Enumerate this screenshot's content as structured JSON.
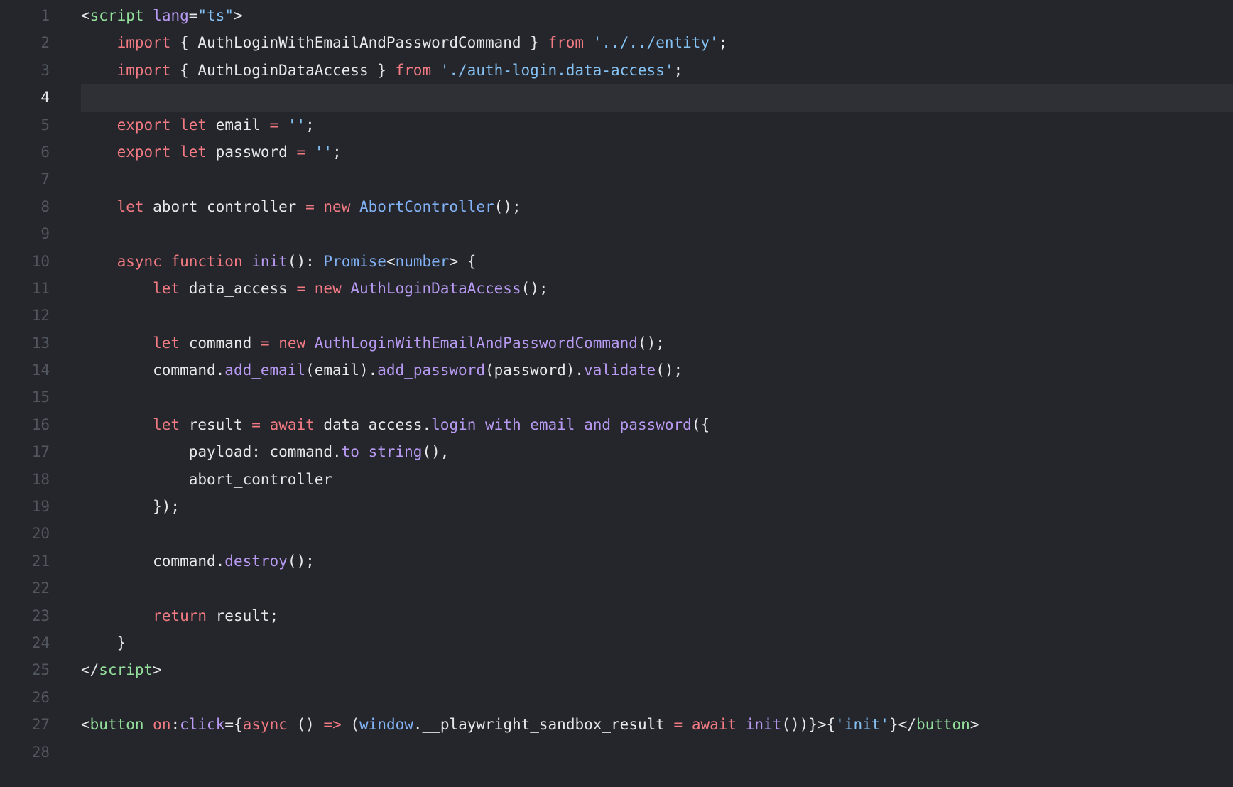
{
  "editor": {
    "active_line": 4,
    "colors": {
      "background": "#24262b",
      "active_line_background": "#2e3036",
      "line_number": "#52565e",
      "line_number_active": "#e4e6ea",
      "plain": "#e7e8ea",
      "keyword": "#f27a83",
      "string": "#85c1f3",
      "type": "#82b1f5",
      "function": "#b99af3",
      "tag": "#93df9b"
    },
    "lines": [
      {
        "n": "1",
        "tokens": [
          [
            "<",
            "punct"
          ],
          [
            "script",
            "tag"
          ],
          [
            " ",
            "plain"
          ],
          [
            "lang",
            "attr"
          ],
          [
            "=",
            "punct"
          ],
          [
            "\"ts\"",
            "str"
          ],
          [
            ">",
            "punct"
          ]
        ]
      },
      {
        "n": "2",
        "tokens": [
          [
            "    ",
            "plain"
          ],
          [
            "import",
            "kw"
          ],
          [
            " { AuthLoginWithEmailAndPasswordCommand } ",
            "plain"
          ],
          [
            "from",
            "kw"
          ],
          [
            " ",
            "plain"
          ],
          [
            "'../../entity'",
            "str"
          ],
          [
            ";",
            "punct"
          ]
        ]
      },
      {
        "n": "3",
        "tokens": [
          [
            "    ",
            "plain"
          ],
          [
            "import",
            "kw"
          ],
          [
            " { AuthLoginDataAccess } ",
            "plain"
          ],
          [
            "from",
            "kw"
          ],
          [
            " ",
            "plain"
          ],
          [
            "'./auth-login.data-access'",
            "str"
          ],
          [
            ";",
            "punct"
          ]
        ]
      },
      {
        "n": "4",
        "tokens": []
      },
      {
        "n": "5",
        "tokens": [
          [
            "    ",
            "plain"
          ],
          [
            "export",
            "kw"
          ],
          [
            " ",
            "plain"
          ],
          [
            "let",
            "kw"
          ],
          [
            " email ",
            "plain"
          ],
          [
            "=",
            "op"
          ],
          [
            " ",
            "plain"
          ],
          [
            "''",
            "str"
          ],
          [
            ";",
            "punct"
          ]
        ]
      },
      {
        "n": "6",
        "tokens": [
          [
            "    ",
            "plain"
          ],
          [
            "export",
            "kw"
          ],
          [
            " ",
            "plain"
          ],
          [
            "let",
            "kw"
          ],
          [
            " password ",
            "plain"
          ],
          [
            "=",
            "op"
          ],
          [
            " ",
            "plain"
          ],
          [
            "''",
            "str"
          ],
          [
            ";",
            "punct"
          ]
        ]
      },
      {
        "n": "7",
        "tokens": []
      },
      {
        "n": "8",
        "tokens": [
          [
            "    ",
            "plain"
          ],
          [
            "let",
            "kw"
          ],
          [
            " abort_controller ",
            "plain"
          ],
          [
            "=",
            "op"
          ],
          [
            " ",
            "plain"
          ],
          [
            "new",
            "kw"
          ],
          [
            " ",
            "plain"
          ],
          [
            "AbortController",
            "type"
          ],
          [
            "();",
            "punct"
          ]
        ]
      },
      {
        "n": "9",
        "tokens": []
      },
      {
        "n": "10",
        "tokens": [
          [
            "    ",
            "plain"
          ],
          [
            "async",
            "kw"
          ],
          [
            " ",
            "plain"
          ],
          [
            "function",
            "kw"
          ],
          [
            " ",
            "plain"
          ],
          [
            "init",
            "fn"
          ],
          [
            "(): ",
            "punct"
          ],
          [
            "Promise",
            "type"
          ],
          [
            "<",
            "punct"
          ],
          [
            "number",
            "type"
          ],
          [
            "> {",
            "punct"
          ]
        ]
      },
      {
        "n": "11",
        "tokens": [
          [
            "        ",
            "plain"
          ],
          [
            "let",
            "kw"
          ],
          [
            " data_access ",
            "plain"
          ],
          [
            "=",
            "op"
          ],
          [
            " ",
            "plain"
          ],
          [
            "new",
            "kw"
          ],
          [
            " ",
            "plain"
          ],
          [
            "AuthLoginDataAccess",
            "fn"
          ],
          [
            "();",
            "punct"
          ]
        ]
      },
      {
        "n": "12",
        "tokens": []
      },
      {
        "n": "13",
        "tokens": [
          [
            "        ",
            "plain"
          ],
          [
            "let",
            "kw"
          ],
          [
            " command ",
            "plain"
          ],
          [
            "=",
            "op"
          ],
          [
            " ",
            "plain"
          ],
          [
            "new",
            "kw"
          ],
          [
            " ",
            "plain"
          ],
          [
            "AuthLoginWithEmailAndPasswordCommand",
            "fn"
          ],
          [
            "();",
            "punct"
          ]
        ]
      },
      {
        "n": "14",
        "tokens": [
          [
            "        command.",
            "plain"
          ],
          [
            "add_email",
            "fn"
          ],
          [
            "(email).",
            "plain"
          ],
          [
            "add_password",
            "fn"
          ],
          [
            "(password).",
            "plain"
          ],
          [
            "validate",
            "fn"
          ],
          [
            "();",
            "punct"
          ]
        ]
      },
      {
        "n": "15",
        "tokens": []
      },
      {
        "n": "16",
        "tokens": [
          [
            "        ",
            "plain"
          ],
          [
            "let",
            "kw"
          ],
          [
            " result ",
            "plain"
          ],
          [
            "=",
            "op"
          ],
          [
            " ",
            "plain"
          ],
          [
            "await",
            "kw"
          ],
          [
            " data_access.",
            "plain"
          ],
          [
            "login_with_email_and_password",
            "fn"
          ],
          [
            "({",
            "punct"
          ]
        ]
      },
      {
        "n": "17",
        "tokens": [
          [
            "            payload: command.",
            "plain"
          ],
          [
            "to_string",
            "fn"
          ],
          [
            "(),",
            "punct"
          ]
        ]
      },
      {
        "n": "18",
        "tokens": [
          [
            "            abort_controller",
            "plain"
          ]
        ]
      },
      {
        "n": "19",
        "tokens": [
          [
            "        });",
            "plain"
          ]
        ]
      },
      {
        "n": "20",
        "tokens": []
      },
      {
        "n": "21",
        "tokens": [
          [
            "        command.",
            "plain"
          ],
          [
            "destroy",
            "fn"
          ],
          [
            "();",
            "punct"
          ]
        ]
      },
      {
        "n": "22",
        "tokens": []
      },
      {
        "n": "23",
        "tokens": [
          [
            "        ",
            "plain"
          ],
          [
            "return",
            "kw"
          ],
          [
            " result;",
            "plain"
          ]
        ]
      },
      {
        "n": "24",
        "tokens": [
          [
            "    }",
            "plain"
          ]
        ]
      },
      {
        "n": "25",
        "tokens": [
          [
            "</",
            "punct"
          ],
          [
            "script",
            "tag"
          ],
          [
            ">",
            "punct"
          ]
        ]
      },
      {
        "n": "26",
        "tokens": []
      },
      {
        "n": "27",
        "tokens": [
          [
            "<",
            "punct"
          ],
          [
            "button",
            "tag"
          ],
          [
            " ",
            "plain"
          ],
          [
            "on",
            "kw"
          ],
          [
            ":",
            "punct"
          ],
          [
            "click",
            "attr"
          ],
          [
            "={",
            "punct"
          ],
          [
            "async",
            "kw"
          ],
          [
            " () ",
            "plain"
          ],
          [
            "=>",
            "op"
          ],
          [
            " (",
            "plain"
          ],
          [
            "window",
            "type"
          ],
          [
            ".__playwright_sandbox_result ",
            "plain"
          ],
          [
            "=",
            "op"
          ],
          [
            " ",
            "plain"
          ],
          [
            "await",
            "kw"
          ],
          [
            " ",
            "plain"
          ],
          [
            "init",
            "fn"
          ],
          [
            "())}>{",
            "punct"
          ],
          [
            "'init'",
            "str"
          ],
          [
            "}</",
            "punct"
          ],
          [
            "button",
            "tag"
          ],
          [
            ">",
            "punct"
          ]
        ]
      },
      {
        "n": "28",
        "tokens": []
      }
    ]
  }
}
